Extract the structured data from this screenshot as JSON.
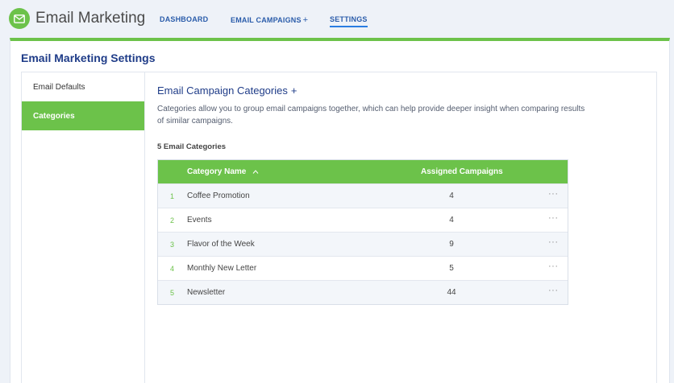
{
  "app": {
    "title": "Email Marketing",
    "icon": "envelope-icon",
    "brand_color": "#6cc24a"
  },
  "nav": {
    "dashboard": "DASHBOARD",
    "campaigns": "EMAIL CAMPAIGNS",
    "campaigns_plus": "+",
    "settings": "SETTINGS"
  },
  "page": {
    "title": "Email Marketing Settings"
  },
  "sidebar": {
    "items": [
      {
        "label": "Email Defaults"
      },
      {
        "label": "Categories"
      }
    ]
  },
  "section": {
    "title": "Email Campaign Categories",
    "plus": "+",
    "description": "Categories allow you to group email campaigns together, which can help provide deeper insight when comparing results of similar campaigns.",
    "count_label": "5 Email Categories"
  },
  "table": {
    "headers": {
      "name": "Category Name",
      "sort": "^",
      "assigned": "Assigned Campaigns"
    },
    "rows": [
      {
        "num": "1",
        "name": "Coffee Promotion",
        "count": "4",
        "menu": "···"
      },
      {
        "num": "2",
        "name": "Events",
        "count": "4",
        "menu": "···"
      },
      {
        "num": "3",
        "name": "Flavor of the Week",
        "count": "9",
        "menu": "···"
      },
      {
        "num": "4",
        "name": "Monthly New Letter",
        "count": "5",
        "menu": "···"
      },
      {
        "num": "5",
        "name": "Newsletter",
        "count": "44",
        "menu": "···"
      }
    ]
  }
}
